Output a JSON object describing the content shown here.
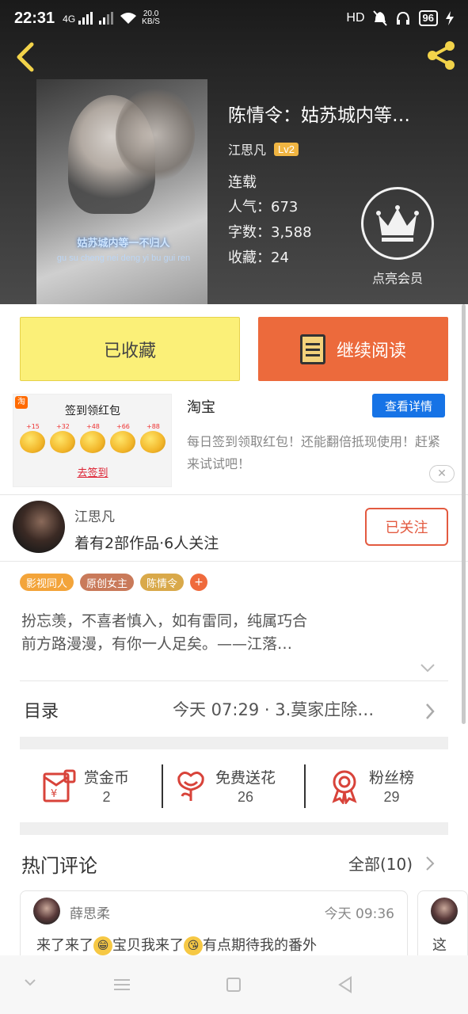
{
  "status_bar": {
    "time": "22:31",
    "signal": "4G",
    "speed": "20.0",
    "speed_unit": "KB/S",
    "hd": "HD",
    "battery": "96"
  },
  "book": {
    "title": "陈情令：姑苏城内等…",
    "author": "江思凡",
    "level": "Lv2",
    "status": "连载",
    "popularity": "人气：673",
    "word_count": "字数：3,588",
    "favorites": "收藏：24",
    "cover_caption_cn": "姑苏城内等一不归人",
    "cover_caption_pinyin": "gu su cheng nei deng yi bu gui ren",
    "vip_label": "点亮会员"
  },
  "actions": {
    "collected": "已收藏",
    "continue_reading": "继续阅读"
  },
  "ad": {
    "image_title": "签到领红包",
    "coin_values": [
      "+15",
      "+32",
      "+48",
      "+66",
      "+88"
    ],
    "image_cta": "去签到",
    "logo": "淘",
    "brand": "淘宝",
    "detail_button": "查看详情",
    "description": "每日签到领取红包！还能翻倍抵现使用！赶紧来试试吧！"
  },
  "author_panel": {
    "name": "江思凡",
    "stats": "着有2部作品·6人关注",
    "follow_button": "已关注"
  },
  "tags": [
    {
      "label": "影视同人",
      "color": "#f3a43a"
    },
    {
      "label": "原创女主",
      "color": "#c97a5a"
    },
    {
      "label": "陈情令",
      "color": "#d9a94a"
    }
  ],
  "tag_add": "+",
  "description_lines": [
    "扮忘羡，不喜者慎入，如有雷同，纯属巧合",
    "前方路漫漫，有你一人足矣。——江落…"
  ],
  "toc": {
    "label": "目录",
    "latest": "今天 07:29 · 3.莫家庄除…"
  },
  "stats": {
    "reward": {
      "label": "赏金币",
      "value": "2"
    },
    "flowers": {
      "label": "免费送花",
      "value": "26"
    },
    "fans": {
      "label": "粉丝榜",
      "value": "29"
    }
  },
  "comments": {
    "title": "热门评论",
    "all": "全部(10)",
    "items": [
      {
        "user": "薛思柔",
        "time": "今天 09:36",
        "text_a": "来了来了",
        "text_b": "宝贝我来了",
        "text_c": "有点期待我的番外"
      }
    ],
    "peek_text": "这"
  },
  "colors": {
    "accent_orange": "#ec6a3c",
    "yellow_button": "#fbf078",
    "blue_button": "#1673e6",
    "red_icon": "#d8433a"
  }
}
